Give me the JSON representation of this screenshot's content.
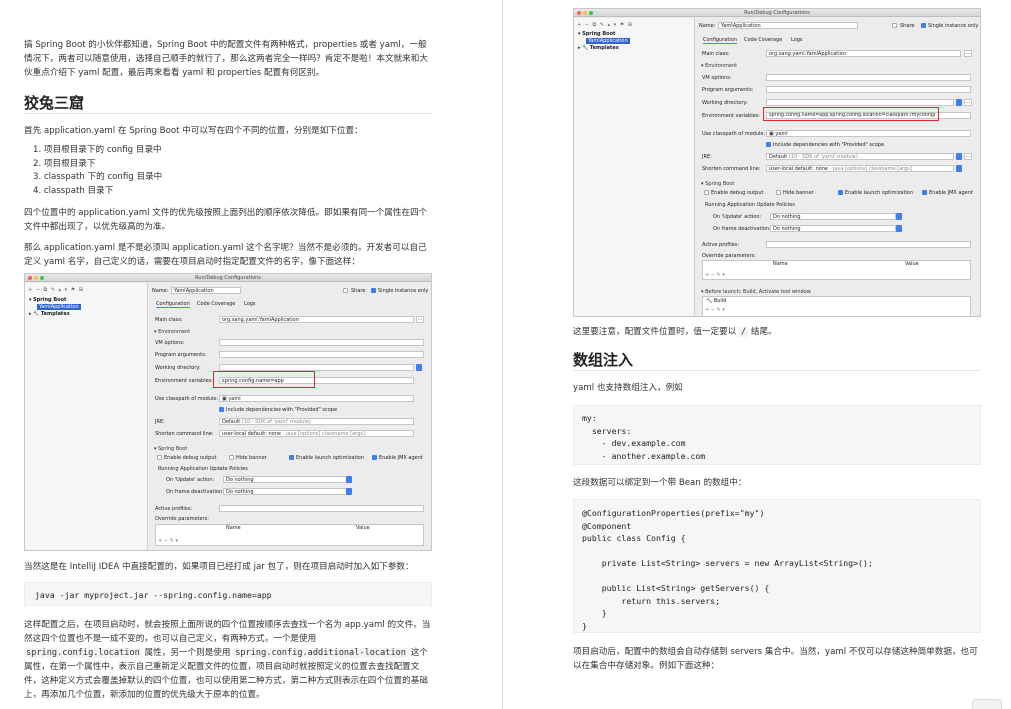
{
  "left": {
    "intro": "搞 Spring Boot 的小伙伴都知道，Spring Boot 中的配置文件有两种格式，properties 或者 yaml，一般情况下，两者可以随意使用，选择自己顺手的就行了，那么这两者完全一样吗？肯定不是啦！本文就来和大伙重点介绍下 yaml 配置，最后再来看看 yaml 和 properties 配置有何区别。",
    "heading": "狡兔三窟",
    "p1": "首先 application.yaml 在 Spring Boot 中可以写在四个不同的位置，分别是如下位置：",
    "list": [
      "1. 项目根目录下的 config 目录中",
      "2. 项目根目录下",
      "3. classpath 下的 config 目录中",
      "4. classpath 目录下"
    ],
    "p2": "四个位置中的 application.yaml 文件的优先级按照上面列出的顺序依次降低。即如果有同一个属性在四个文件中都出现了，以优先级高的为准。",
    "p3": "那么 application.yaml 是不是必须叫 application.yaml 这个名字呢？当然不是必须的。开发者可以自己定义 yaml 名字，自己定义的话，需要在项目启动时指定配置文件的名字，像下面这样：",
    "p4": "当然这是在 IntelliJ IDEA 中直接配置的，如果项目已经打成 jar 包了，则在项目启动时加入如下参数：",
    "code": "java -jar myproject.jar --spring.config.name=app",
    "p5_a": "这样配置之后，在项目启动时，就会按照上面所说的四个位置按顺序去查找一个名为 app.yaml 的文件。当然这四个位置也不是一成不变的，也可以自己定义，有两种方式，一个是使用",
    "p5_code1": "spring.config.location",
    "p5_b": " 属性，另一个则是使用 ",
    "p5_code2": "spring.config.additional-location",
    "p5_c": " 这个属性，在第一个属性中，表示自己重新定义配置文件的位置，项目启动时就按照定义的位置去查找配置文件，这种定义方式会覆盖掉默认的四个位置，也可以使用第二种方式，第二种方式则表示在四个位置的基础上，再添加几个位置，新添加的位置的优先级大于原本的位置。"
  },
  "right": {
    "p1_a": "这里要注意，配置文件位置时，值一定要以 ",
    "p1_code": "/",
    "p1_b": " 结尾。",
    "heading": "数组注入",
    "p2": "yaml 也支持数组注入，例如",
    "code1": "my:\n  servers:\n    - dev.example.com\n    - another.example.com",
    "p3": "这段数据可以绑定到一个带 Bean 的数组中：",
    "code2": "@ConfigurationProperties(prefix=\"my\")\n@Component\npublic class Config {\n\n    private List<String> servers = new ArrayList<String>();\n\n    public List<String> getServers() {\n        return this.servers;\n    }\n}",
    "p4": "项目启动后，配置中的数组会自动存储到 servers 集合中。当然，yaml 不仅可以存储这种简单数据，也可以在集合中存储对象。例如下面这种："
  },
  "ide": {
    "title": "Run/Debug Configurations",
    "toolbar": "+ − ⧉ ✎ ▴ ▾ ⚑ ⊞",
    "tree_root": "Spring Boot",
    "tree_selected": "YamlApplication",
    "tree_templates": "Templates",
    "name_label": "Name:",
    "name_value": "YamlApplication",
    "share_label": "Share",
    "single_label": "Single instance only",
    "tabs": [
      "Configuration",
      "Code Coverage",
      "Logs"
    ],
    "main_class_label": "Main class:",
    "main_class_value": "org.sang.yaml.YamlApplication",
    "environment_label": "▾ Environment",
    "vm_label": "VM options:",
    "prog_label": "Program arguments:",
    "workdir_label": "Working directory:",
    "env_label": "Environment variables:",
    "env_value_left": "spring.config.name=app",
    "env_value_right": "spring.config.name=app;spring.config.location=classpath:/myconfig/",
    "classpath_label": "Use classpath of module:",
    "classpath_value": "yaml",
    "include_label": "Include dependencies with \"Provided\" scope",
    "jre_label": "JRE:",
    "jre_value": "Default",
    "jre_hint": "(10 - SDK of 'yaml' module)",
    "shorten_label": "Shorten command line:",
    "shorten_value": "user-local default: none",
    "shorten_hint": "- java [options] classname [args]",
    "springboot_label": "▾ Spring Boot",
    "debug_label": "Enable debug output",
    "hide_label": "Hide banner",
    "launch_label": "Enable launch optimization",
    "jmx_label": "Enable JMX agent",
    "policies_label": "Running Application Update Policies",
    "update_label": "On 'Update' action:",
    "frame_label": "On frame deactivation:",
    "nothing": "Do nothing",
    "profiles_label": "Active profiles:",
    "override_label": "Override parameters:",
    "col_name": "Name",
    "col_value": "Value",
    "bottom_toolbar": "+ − ✎ ▾",
    "before_launch": "▾ Before launch: Build, Activate tool window",
    "build_item": "Build"
  }
}
